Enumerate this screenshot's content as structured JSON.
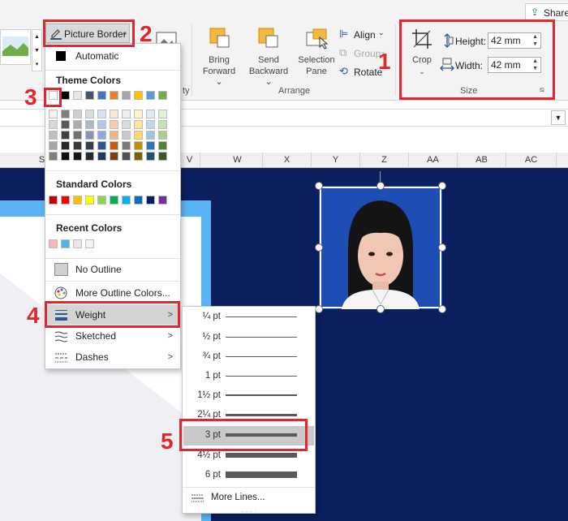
{
  "ribbon": {
    "share_label": "Share",
    "picture_border_label": "Picture Border",
    "arrange": {
      "bring_forward": [
        "Bring",
        "Forward"
      ],
      "send_backward": [
        "Send",
        "Backward"
      ],
      "selection_pane": [
        "Selection",
        "Pane"
      ],
      "align": "Align",
      "group": "Group",
      "rotate": "Rotate",
      "group_label": "Arrange"
    },
    "size": {
      "crop": "Crop",
      "height_label": "Height:",
      "height_value": "42 mm",
      "width_label": "Width:",
      "width_value": "42 mm",
      "group_label": "Size"
    },
    "styles_group_tail": "ty"
  },
  "columns": [
    "S",
    "V",
    "W",
    "X",
    "Y",
    "Z",
    "AA",
    "AB",
    "AC"
  ],
  "dropdown": {
    "automatic": "Automatic",
    "theme_colors_head": "Theme Colors",
    "theme_top": [
      "#ffffff",
      "#000000",
      "#e7e6e6",
      "#44546a",
      "#4472c4",
      "#ed7d31",
      "#a5a5a5",
      "#ffc000",
      "#5b9bd5",
      "#70ad47"
    ],
    "theme_shades": [
      [
        "#f2f2f2",
        "#7f7f7f",
        "#d0cece",
        "#d6dce4",
        "#d9e2f3",
        "#fbe5d5",
        "#ededed",
        "#fff2cc",
        "#deebf6",
        "#e2efd9"
      ],
      [
        "#d8d8d8",
        "#595959",
        "#aeabab",
        "#adb9ca",
        "#b4c6e7",
        "#f7cbac",
        "#dbdbdb",
        "#fee599",
        "#bdd7ee",
        "#c5e0b3"
      ],
      [
        "#bfbfbf",
        "#3f3f3f",
        "#757070",
        "#8496b0",
        "#8eaadb",
        "#f4b183",
        "#c9c9c9",
        "#ffd965",
        "#9cc3e5",
        "#a8d08d"
      ],
      [
        "#a5a5a5",
        "#262626",
        "#3a3838",
        "#323f4f",
        "#2f5496",
        "#c55a11",
        "#7b7b7b",
        "#bf9000",
        "#2e75b5",
        "#538135"
      ],
      [
        "#7f7f7f",
        "#0c0c0c",
        "#161616",
        "#222a35",
        "#1f3864",
        "#833c0b",
        "#525252",
        "#7f6000",
        "#1e4e79",
        "#375623"
      ]
    ],
    "standard_colors_head": "Standard Colors",
    "standard_colors": [
      "#c00000",
      "#ff0000",
      "#ffc000",
      "#ffff00",
      "#92d050",
      "#00b050",
      "#00b0f0",
      "#0070c0",
      "#002060",
      "#7030a0"
    ],
    "recent_colors_head": "Recent Colors",
    "recent_colors": [
      "#f4b6c2",
      "#4eb3f0",
      "#e8e8e8",
      "#f2f2f2"
    ],
    "no_outline": "No Outline",
    "more_outline_colors": "More Outline Colors...",
    "weight": "Weight",
    "sketched": "Sketched",
    "dashes": "Dashes"
  },
  "weights": [
    {
      "label": "¼ pt",
      "pt": 0.25
    },
    {
      "label": "½ pt",
      "pt": 0.5
    },
    {
      "label": "¾ pt",
      "pt": 0.75
    },
    {
      "label": "1 pt",
      "pt": 1
    },
    {
      "label": "1½ pt",
      "pt": 1.5
    },
    {
      "label": "2¼ pt",
      "pt": 2.25
    },
    {
      "label": "3 pt",
      "pt": 3
    },
    {
      "label": "4½ pt",
      "pt": 4.5
    },
    {
      "label": "6 pt",
      "pt": 6
    }
  ],
  "more_lines": "More Lines...",
  "annotations": [
    "1",
    "2",
    "3",
    "4",
    "5"
  ],
  "colors": {
    "annotation": "#e0272d",
    "slide_bg": "#0b1f5e",
    "highlight": "#c9c9c9"
  }
}
